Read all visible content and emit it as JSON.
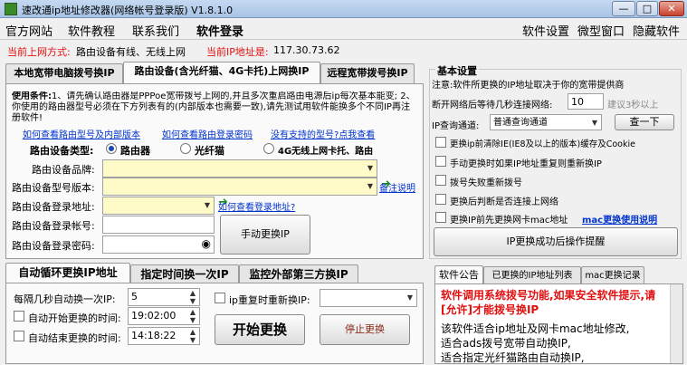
{
  "window": {
    "title": "速改通ip地址修改器(网络帐号登录版) V1.8.1.0",
    "min": "—",
    "max": "□",
    "close": "✕"
  },
  "menu": {
    "left": [
      "官方网站",
      "软件教程",
      "联系我们"
    ],
    "login": "软件登录",
    "right": [
      "软件设置",
      "微型窗口",
      "隐藏软件"
    ]
  },
  "info": {
    "mode_label": "当前上网方式:",
    "mode_value": "路由设备有线、无线上网",
    "ip_label": "当前IP地址是:",
    "ip_value": "117.30.73.62"
  },
  "tabs": [
    "本地宽带电脑拨号换IP",
    "路由设备(含光纤猫、4G卡托)上网换IP",
    "远程宽带拨号换IP"
  ],
  "router": {
    "usage_title": "使用条件:",
    "usage_text": "1、请先确认路由器是PPPoe宽带拨号上网的,并且多次重启路由电源后ip每次基本能变; 2、你使用的路由器型号必须在下方列表有的(内部版本也需要一致),请先测试用软件能换多个不同IP再注册软件!",
    "links": [
      "如何查看路由型号及内部版本",
      "如何查看路由登录密码",
      "没有支持的型号?点我查看"
    ],
    "type_label": "路由设备类型:",
    "types": [
      "路由器",
      "光纤猫",
      "4G无线上网卡托、路由"
    ],
    "brand_label": "路由设备品牌:",
    "model_label": "路由设备型号版本:",
    "model_note": "备注说明",
    "addr_label": "路由设备登录地址:",
    "addr_link": "如何查看登录地址?",
    "acct_label": "路由设备登录帐号:",
    "pwd_label": "路由设备登录密码:",
    "manual_btn": "手动更换IP",
    "eye_icon": "◉"
  },
  "auto_tabs": [
    "自动循环更换IP地址",
    "指定时间换一次IP",
    "监控外部第三方换IP"
  ],
  "auto": {
    "interval_label": "每隔几秒自动换一次IP:",
    "interval_value": "5",
    "repeat_label": "ip重复时重新换IP:",
    "start_label": "自动开始更换的时间:",
    "start_time": "19:02:00",
    "end_label": "自动结束更换的时间:",
    "end_time": "14:18:22",
    "start_btn": "开始更换",
    "stop_btn": "停止更换"
  },
  "settings": {
    "title": "基本设置",
    "note": "注意:软件所更换的IP地址取决于你的宽带提供商",
    "wait_label": "断开网络后等待几秒连接网络:",
    "wait_value": "10",
    "wait_hint": "建议3秒以上",
    "query_label": "IP查询通道:",
    "query_value": "普通查询通道",
    "query_btn": "查一下",
    "opts": [
      "更换ip前清除IE(IE8及以上的版本)缓存及Cookie",
      "手动更换时如果IP地址重复则重新换IP",
      "拨号失败重新拨号",
      "更换后判断是否连接上网络",
      "更换IP前先更换网卡mac地址"
    ],
    "mac_link": "mac更换使用说明",
    "remind_btn": "IP更换成功后操作提醒"
  },
  "notice_tabs": [
    "软件公告",
    "已更换的IP地址列表",
    "mac更换记录"
  ],
  "notice": {
    "headline": "软件调用系统拨号功能,如果安全软件提示,请[允许]才能拨号换IP",
    "lines": [
      "该软件适合ip地址及网卡mac地址修改,",
      "适合ads拨号宽带自动换IP,",
      "适合指定光纤猫路由自动换IP,"
    ]
  }
}
